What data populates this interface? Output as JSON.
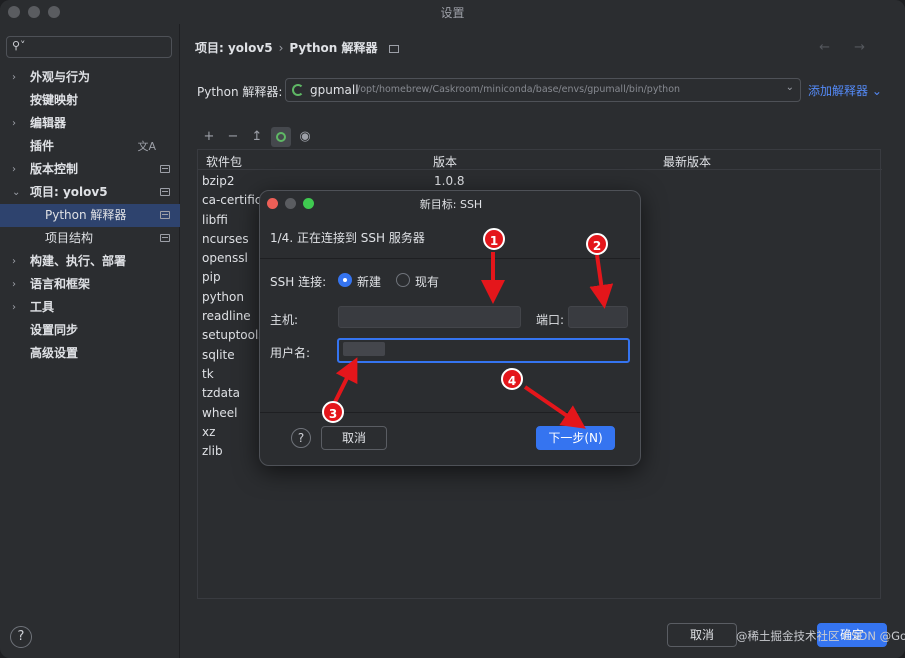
{
  "window": {
    "title": "设置"
  },
  "sidebar": {
    "search_placeholder": "",
    "items": [
      {
        "label": "外观与行为",
        "chevron": "›"
      },
      {
        "label": "按键映射",
        "chevron": ""
      },
      {
        "label": "编辑器",
        "chevron": "›"
      },
      {
        "label": "插件",
        "chevron": ""
      },
      {
        "label": "版本控制",
        "chevron": "›"
      },
      {
        "label": "项目: yolov5",
        "chevron": "⌄"
      },
      {
        "label": "Python 解释器",
        "chevron": ""
      },
      {
        "label": "项目结构",
        "chevron": ""
      },
      {
        "label": "构建、执行、部署",
        "chevron": "›"
      },
      {
        "label": "语言和框架",
        "chevron": "›"
      },
      {
        "label": "工具",
        "chevron": "›"
      },
      {
        "label": "设置同步",
        "chevron": ""
      },
      {
        "label": "高级设置",
        "chevron": ""
      }
    ],
    "help": "?"
  },
  "main": {
    "breadcrumb": {
      "project": "项目: yolov5",
      "separator": "›",
      "page": "Python 解释器"
    },
    "nav_arrows": "← →",
    "interpreter": {
      "label": "Python 解释器:",
      "name": "gpumall",
      "path": "/opt/homebrew/Caskroom/miniconda/base/envs/gpumall/bin/python",
      "add_link": "添加解释器 ⌄"
    },
    "toolbar": {
      "add": "+",
      "remove": "−",
      "upgrade": "↥",
      "show": "◉"
    },
    "table": {
      "columns": [
        "软件包",
        "版本",
        "最新版本"
      ],
      "rows": [
        {
          "name": "bzip2",
          "version": "1.0.8"
        },
        {
          "name": "ca-certific",
          "version": ""
        },
        {
          "name": "libffi",
          "version": ""
        },
        {
          "name": "ncurses",
          "version": ""
        },
        {
          "name": "openssl",
          "version": ""
        },
        {
          "name": "pip",
          "version": ""
        },
        {
          "name": "python",
          "version": ""
        },
        {
          "name": "readline",
          "version": ""
        },
        {
          "name": "setuptools",
          "version": ""
        },
        {
          "name": "sqlite",
          "version": ""
        },
        {
          "name": "tk",
          "version": ""
        },
        {
          "name": "tzdata",
          "version": ""
        },
        {
          "name": "wheel",
          "version": ""
        },
        {
          "name": "xz",
          "version": ""
        },
        {
          "name": "zlib",
          "version": ""
        }
      ]
    },
    "footer": {
      "cancel": "取消",
      "ok": "确定",
      "watermark": "@稀土掘金技术社区 CSDN @GolemaK"
    }
  },
  "dialog": {
    "title": "新目标: SSH",
    "step": "1/4. 正在连接到 SSH 服务器",
    "ssh_label": "SSH 连接:",
    "radio_new": "新建",
    "radio_existing": "现有",
    "host_label": "主机:",
    "port_label": "端口:",
    "username_label": "用户名:",
    "host_value": "",
    "port_value": "",
    "username_value": "",
    "help": "?",
    "cancel": "取消",
    "next": "下一步(N)"
  },
  "annotations": [
    "1",
    "2",
    "3",
    "4"
  ],
  "colors": {
    "accent": "#3574f0",
    "marker": "#e4161b",
    "link": "#548af7",
    "conda_ring": "#5fb865"
  }
}
